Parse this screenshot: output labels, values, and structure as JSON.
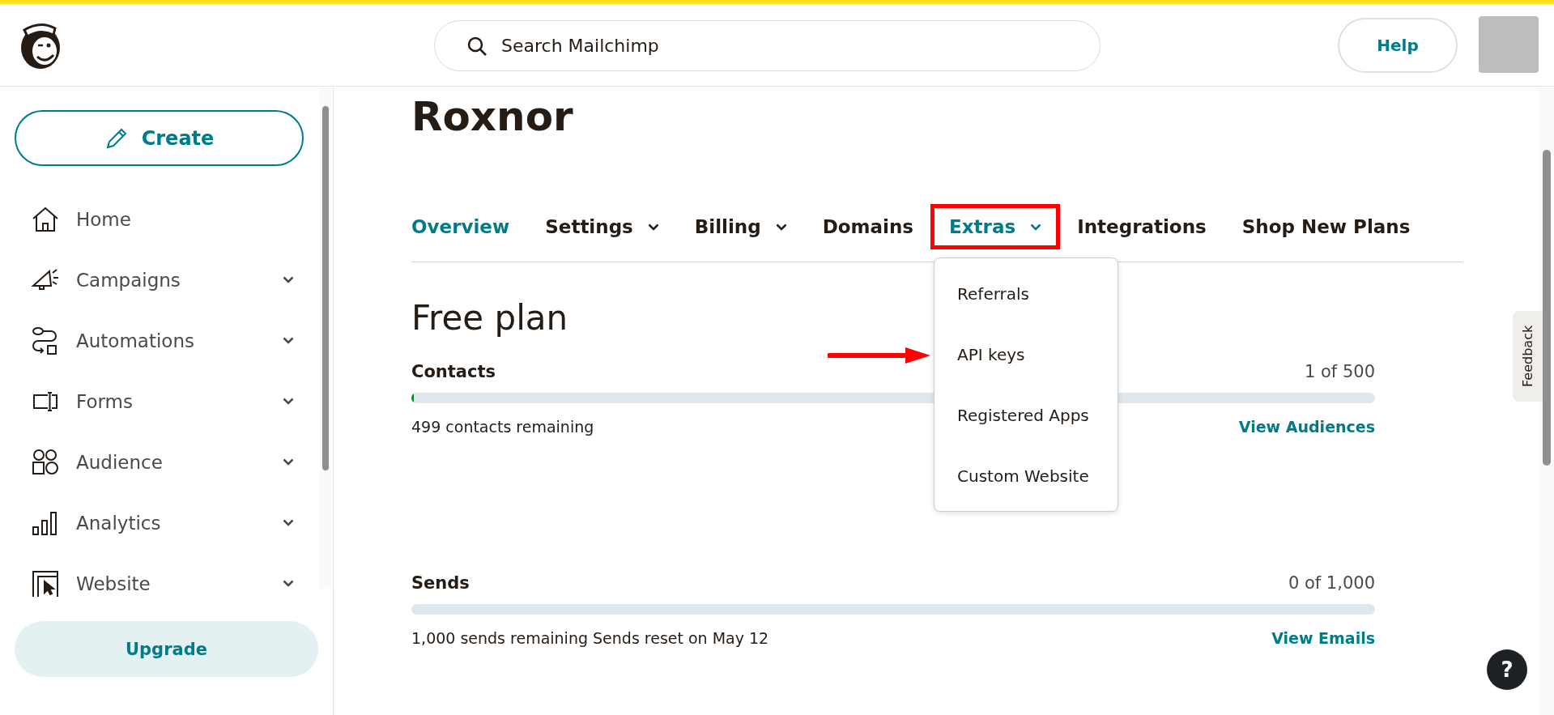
{
  "header": {
    "search": {
      "placeholder": "Search Mailchimp"
    },
    "help_button": "Help"
  },
  "sidebar": {
    "create_button": "Create",
    "items": [
      {
        "label": "Home",
        "expandable": false
      },
      {
        "label": "Campaigns",
        "expandable": true
      },
      {
        "label": "Automations",
        "expandable": true
      },
      {
        "label": "Forms",
        "expandable": true
      },
      {
        "label": "Audience",
        "expandable": true
      },
      {
        "label": "Analytics",
        "expandable": true
      },
      {
        "label": "Website",
        "expandable": true
      }
    ],
    "upgrade_button": "Upgrade"
  },
  "main": {
    "title": "Roxnor",
    "tabs": [
      {
        "label": "Overview",
        "selected": true,
        "has_dropdown": false,
        "annotated": false
      },
      {
        "label": "Settings",
        "selected": false,
        "has_dropdown": true,
        "annotated": false
      },
      {
        "label": "Billing",
        "selected": false,
        "has_dropdown": true,
        "annotated": false
      },
      {
        "label": "Domains",
        "selected": false,
        "has_dropdown": false,
        "annotated": false
      },
      {
        "label": "Extras",
        "selected": true,
        "has_dropdown": true,
        "annotated": true
      },
      {
        "label": "Integrations",
        "selected": false,
        "has_dropdown": false,
        "annotated": false
      },
      {
        "label": "Shop New Plans",
        "selected": false,
        "has_dropdown": false,
        "annotated": false
      }
    ],
    "dropdown": [
      {
        "label": "Referrals",
        "pointed": false
      },
      {
        "label": "API keys",
        "pointed": true
      },
      {
        "label": "Registered Apps",
        "pointed": false
      },
      {
        "label": "Custom Website",
        "pointed": false
      }
    ],
    "plan_title": "Free plan",
    "usage": [
      {
        "label": "Contacts",
        "count": "1 of 500",
        "level": 0.002,
        "remaining": "499 contacts remaining",
        "link": "View Audiences"
      },
      {
        "label": "Sends",
        "count": "0 of 1,000",
        "level": 0,
        "remaining": "1,000 sends remaining Sends reset on May 12",
        "link": "View Emails"
      }
    ]
  },
  "feedback_tab": "Feedback",
  "help_fab": "?"
}
